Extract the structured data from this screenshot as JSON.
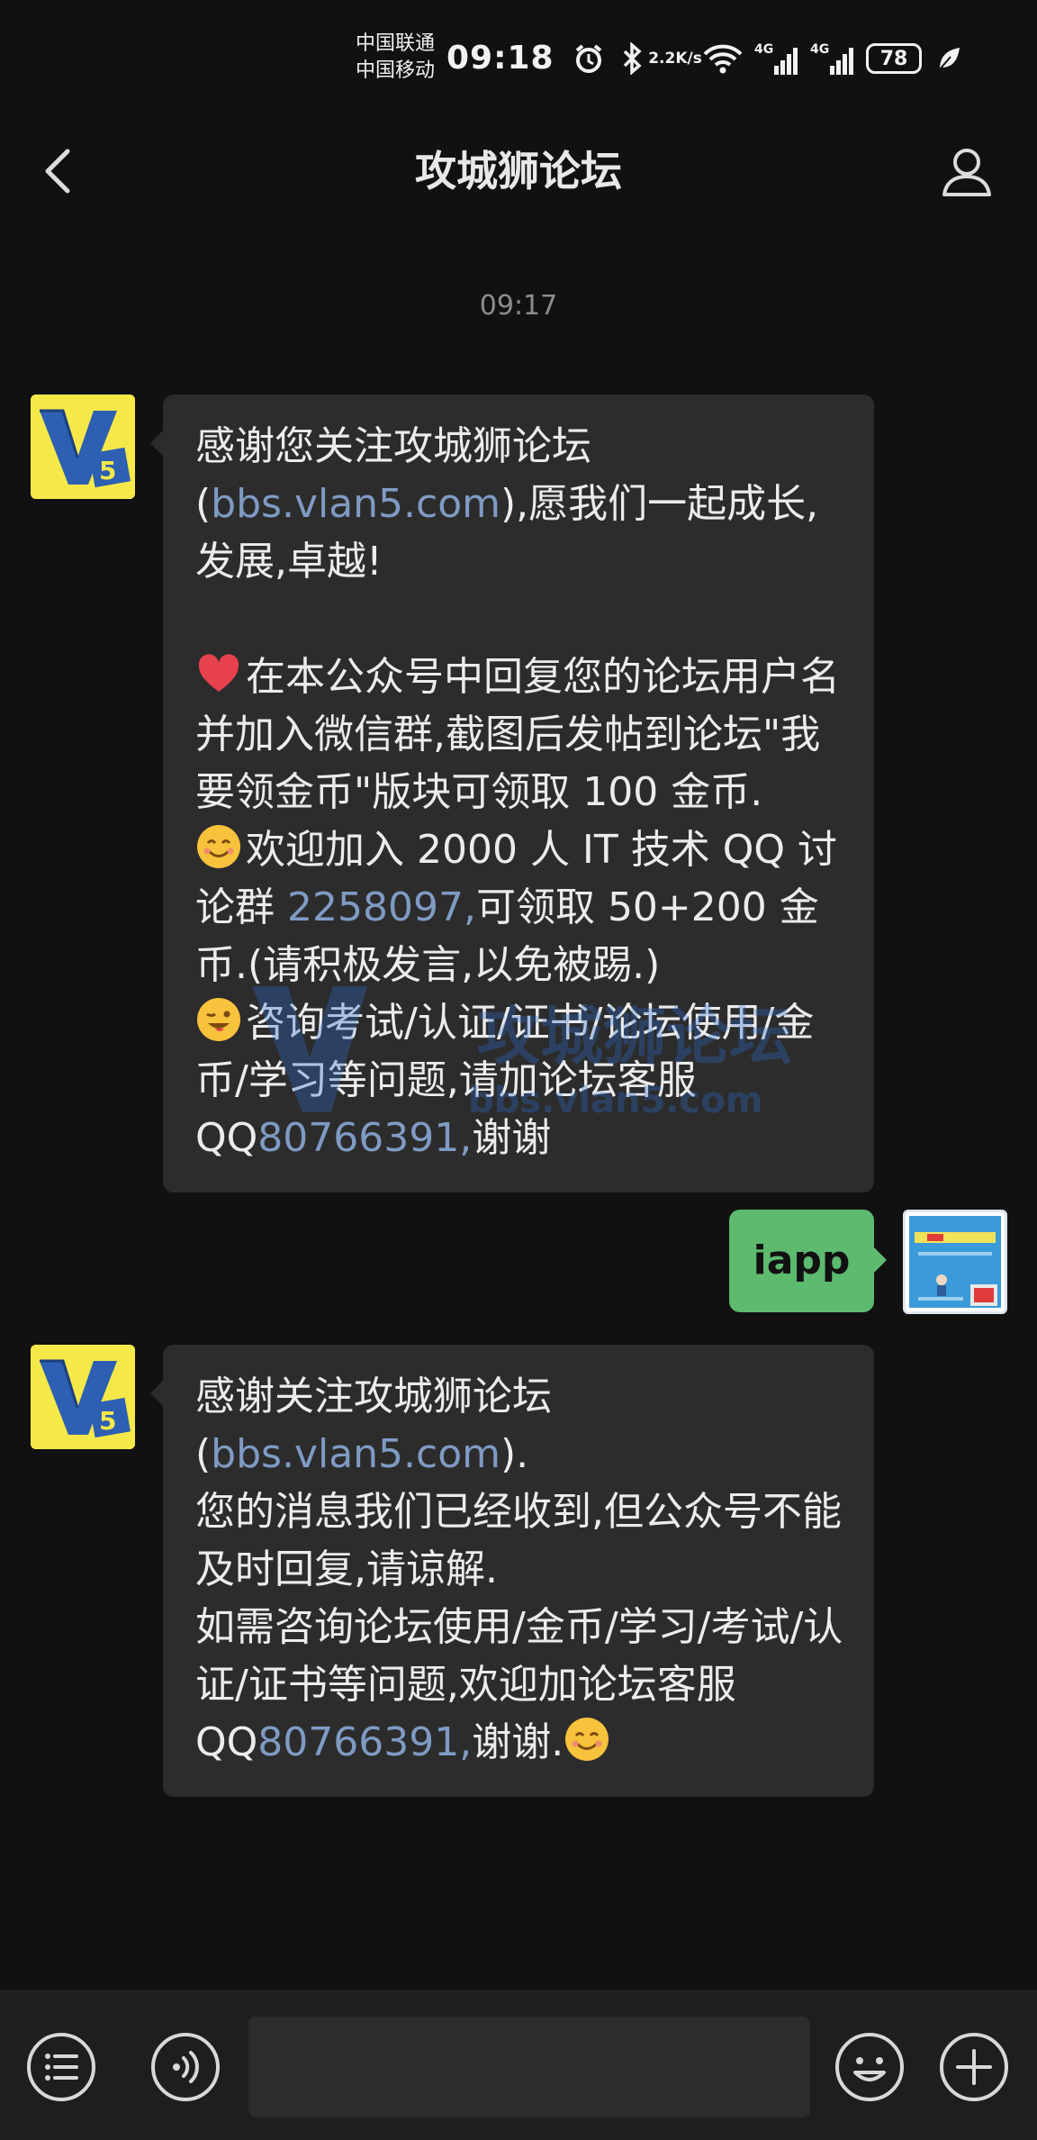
{
  "status_bar": {
    "carrier_1": "中国联通",
    "carrier_2": "中国移动",
    "time": "09:18",
    "speed_top": "2.2",
    "speed_bottom": "K/s",
    "battery": "78",
    "icons": [
      "alarm-icon",
      "bluetooth-icon",
      "wifi-icon",
      "signal-4g-icon",
      "signal-4g-icon",
      "battery-icon",
      "leaf-icon"
    ]
  },
  "nav": {
    "title": "攻城狮论坛",
    "back_icon": "chevron-left-icon",
    "profile_icon": "person-icon"
  },
  "chat": {
    "timestamp": "09:17",
    "messages": [
      {
        "sender": "official",
        "p1_a": "感谢您关注攻城狮论坛(",
        "p1_link": "bbs.vlan5.com",
        "p1_b": "),愿我们一起成长,发展,卓越!",
        "p2": "在本公众号中回复您的论坛用户名并加入微信群,截图后发帖到论坛\"我要领金币\"版块可领取 100 金币.",
        "p3_a": "欢迎加入 2000 人 IT 技术 QQ 讨论群 ",
        "p3_link": "2258097,",
        "p3_b": "可领取 50+200 金币.(请积极发言,以免被踢.)",
        "p4_a": "咨询考试/认证/证书/论坛使用/金币/学习等问题,请加论坛客服 QQ",
        "p4_link": "80766391,",
        "p4_b": "谢谢"
      },
      {
        "sender": "me",
        "text": "iapp"
      },
      {
        "sender": "official",
        "p1_a": "感谢关注攻城狮论坛(",
        "p1_link": "bbs.vlan5.com",
        "p1_b": ").",
        "p2": "您的消息我们已经收到,但公众号不能及时回复,请谅解.",
        "p3_a": "如需咨询论坛使用/金币/学习/考试/认证/证书等问题,欢迎加论坛客服 QQ",
        "p3_link": "80766391,",
        "p3_b": "谢谢."
      }
    ],
    "watermark_title": "攻城狮论坛",
    "watermark_url": "bbs.vlan5.com"
  },
  "input_bar": {
    "menu_icon": "list-menu-icon",
    "voice_icon": "voice-icon",
    "emoji_icon": "emoji-icon",
    "plus_icon": "plus-icon",
    "placeholder": ""
  },
  "colors": {
    "background": "#111111",
    "bubble_incoming": "#2c2c2c",
    "bubble_outgoing": "#5dba6e",
    "link": "#7f9bc4",
    "text": "#ececec"
  }
}
